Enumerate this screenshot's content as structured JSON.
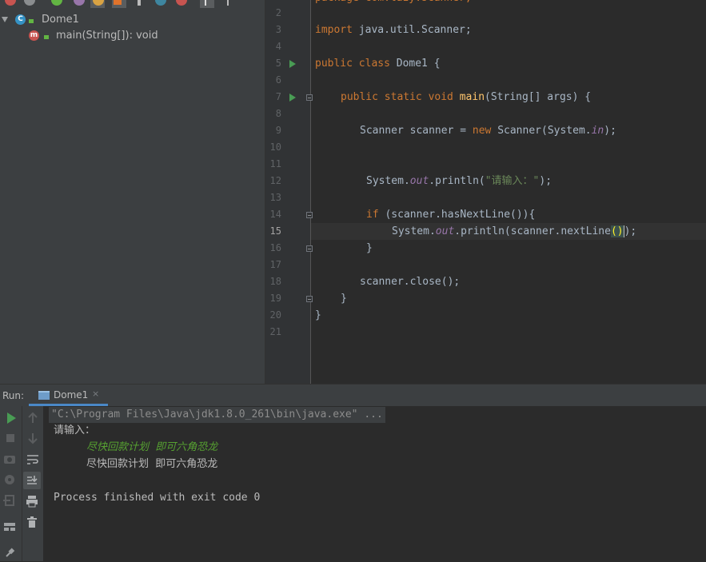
{
  "structure": {
    "class_name": "Dome1",
    "class_icon_letter": "C",
    "method_icon_letter": "m",
    "method": "main(String[]): void"
  },
  "editor": {
    "line_numbers": [
      "2",
      "3",
      "4",
      "5",
      "6",
      "7",
      "8",
      "9",
      "10",
      "11",
      "12",
      "13",
      "14",
      "15",
      "16",
      "17",
      "18",
      "19",
      "20",
      "21"
    ],
    "current_line": "15",
    "code": {
      "l3": {
        "kw": "import",
        "rest": " java.util.Scanner;"
      },
      "l5": {
        "kw": "public class",
        "rest": " Dome1 {"
      },
      "l7": {
        "kw": "public static void",
        "fn": "main",
        "rest": "(String[] args) {"
      },
      "l9": {
        "a": "Scanner scanner = ",
        "kw": "new",
        "b": " Scanner(System.",
        "st": "in",
        "c": ");"
      },
      "l12": {
        "a": "System.",
        "st": "out",
        "b": ".println(",
        "str": "\"请输入：\"",
        "c": ");"
      },
      "l14": {
        "kw": "if",
        "rest": " (scanner.hasNextLine()){"
      },
      "l15": {
        "a": "System.",
        "st": "out",
        "b": ".println(scanner.nextLine",
        "paren": "()",
        "c": ");"
      },
      "l16": "}",
      "l18": "scanner.close();",
      "l19": "}",
      "l20": "}"
    }
  },
  "run": {
    "label": "Run:",
    "tab": "Dome1",
    "close": "×",
    "console": {
      "cmd": "\"C:\\Program Files\\Java\\jdk1.8.0_261\\bin\\java.exe\" ...",
      "prompt": "请输入：",
      "input": "尽快回款计划  即可六角恐龙",
      "output": "尽快回款计划  即可六角恐龙",
      "exit": "Process finished with exit code 0"
    }
  },
  "colors": {
    "background": "#2b2b2b",
    "panel": "#3c3f41",
    "keyword": "#cc7832",
    "function": "#ffc66d",
    "static_field": "#9876aa",
    "string": "#6a8759",
    "run_green": "#499c54",
    "user_input_green": "#56a131"
  }
}
